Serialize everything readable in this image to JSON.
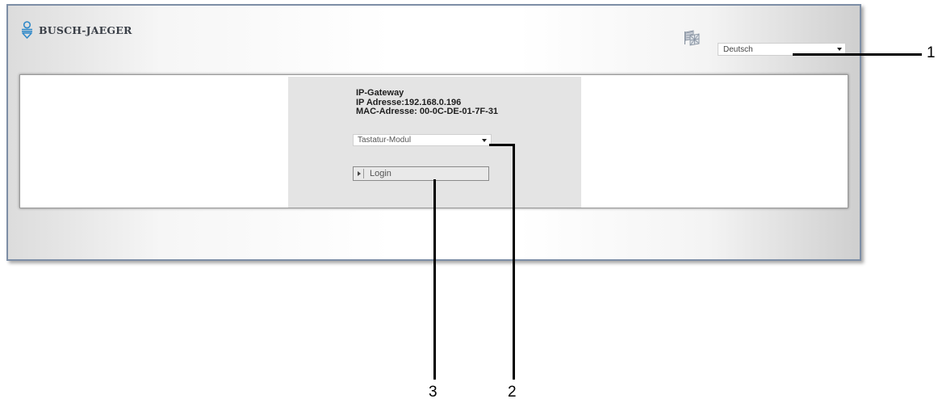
{
  "header": {
    "brand_name": "BUSCH-JAEGER",
    "language_select": {
      "value": "Deutsch"
    },
    "language_icon": "flags-icon"
  },
  "login_box": {
    "title": "IP-Gateway",
    "ip_line": "IP Adresse:192.168.0.196",
    "mac_line": "MAC-Adresse: 00-0C-DE-01-7F-31",
    "module_select": {
      "value": "Tastatur-Modul"
    },
    "login_button": {
      "label": "Login"
    }
  },
  "callouts": [
    {
      "number": "1"
    },
    {
      "number": "2"
    },
    {
      "number": "3"
    }
  ],
  "colors": {
    "window_border": "#7d8ea6",
    "login_box_bg": "#e4e4e4",
    "logo_blue": "#2f88c8"
  }
}
